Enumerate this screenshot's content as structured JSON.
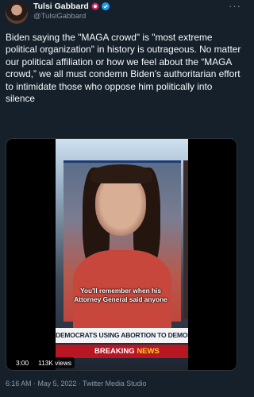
{
  "author": {
    "display_name": "Tulsi Gabbard",
    "handle": "@TulsiGabbard",
    "badge_icons": [
      "rose-icon",
      "verified-icon"
    ]
  },
  "more_label": "···",
  "tweet": {
    "text": "Biden saying the \"MAGA crowd\" is \"most extreme political organization\" in history is outrageous. No matter our political affiliation or how we feel about the “MAGA crowd,” we all must condemn Biden's authoritarian effort to intimidate those who oppose him politically into silence"
  },
  "video": {
    "caption": "You'll remember when his Attorney General said anyone",
    "chyron": "DEMOCRATS USING ABORTION TO DEMONIZE REPUBLICANS",
    "breaking_label": "BREAKING",
    "news_label": "NEWS",
    "duration": "3:00",
    "views": "113K views"
  },
  "meta": {
    "line": "6:16 AM · May 5, 2022 · Twitter Media Studio"
  },
  "colors": {
    "background": "#15202b",
    "verified": "#1d9bf0",
    "secondary_text": "#8b98a5",
    "breaking_red": "#b91624"
  }
}
